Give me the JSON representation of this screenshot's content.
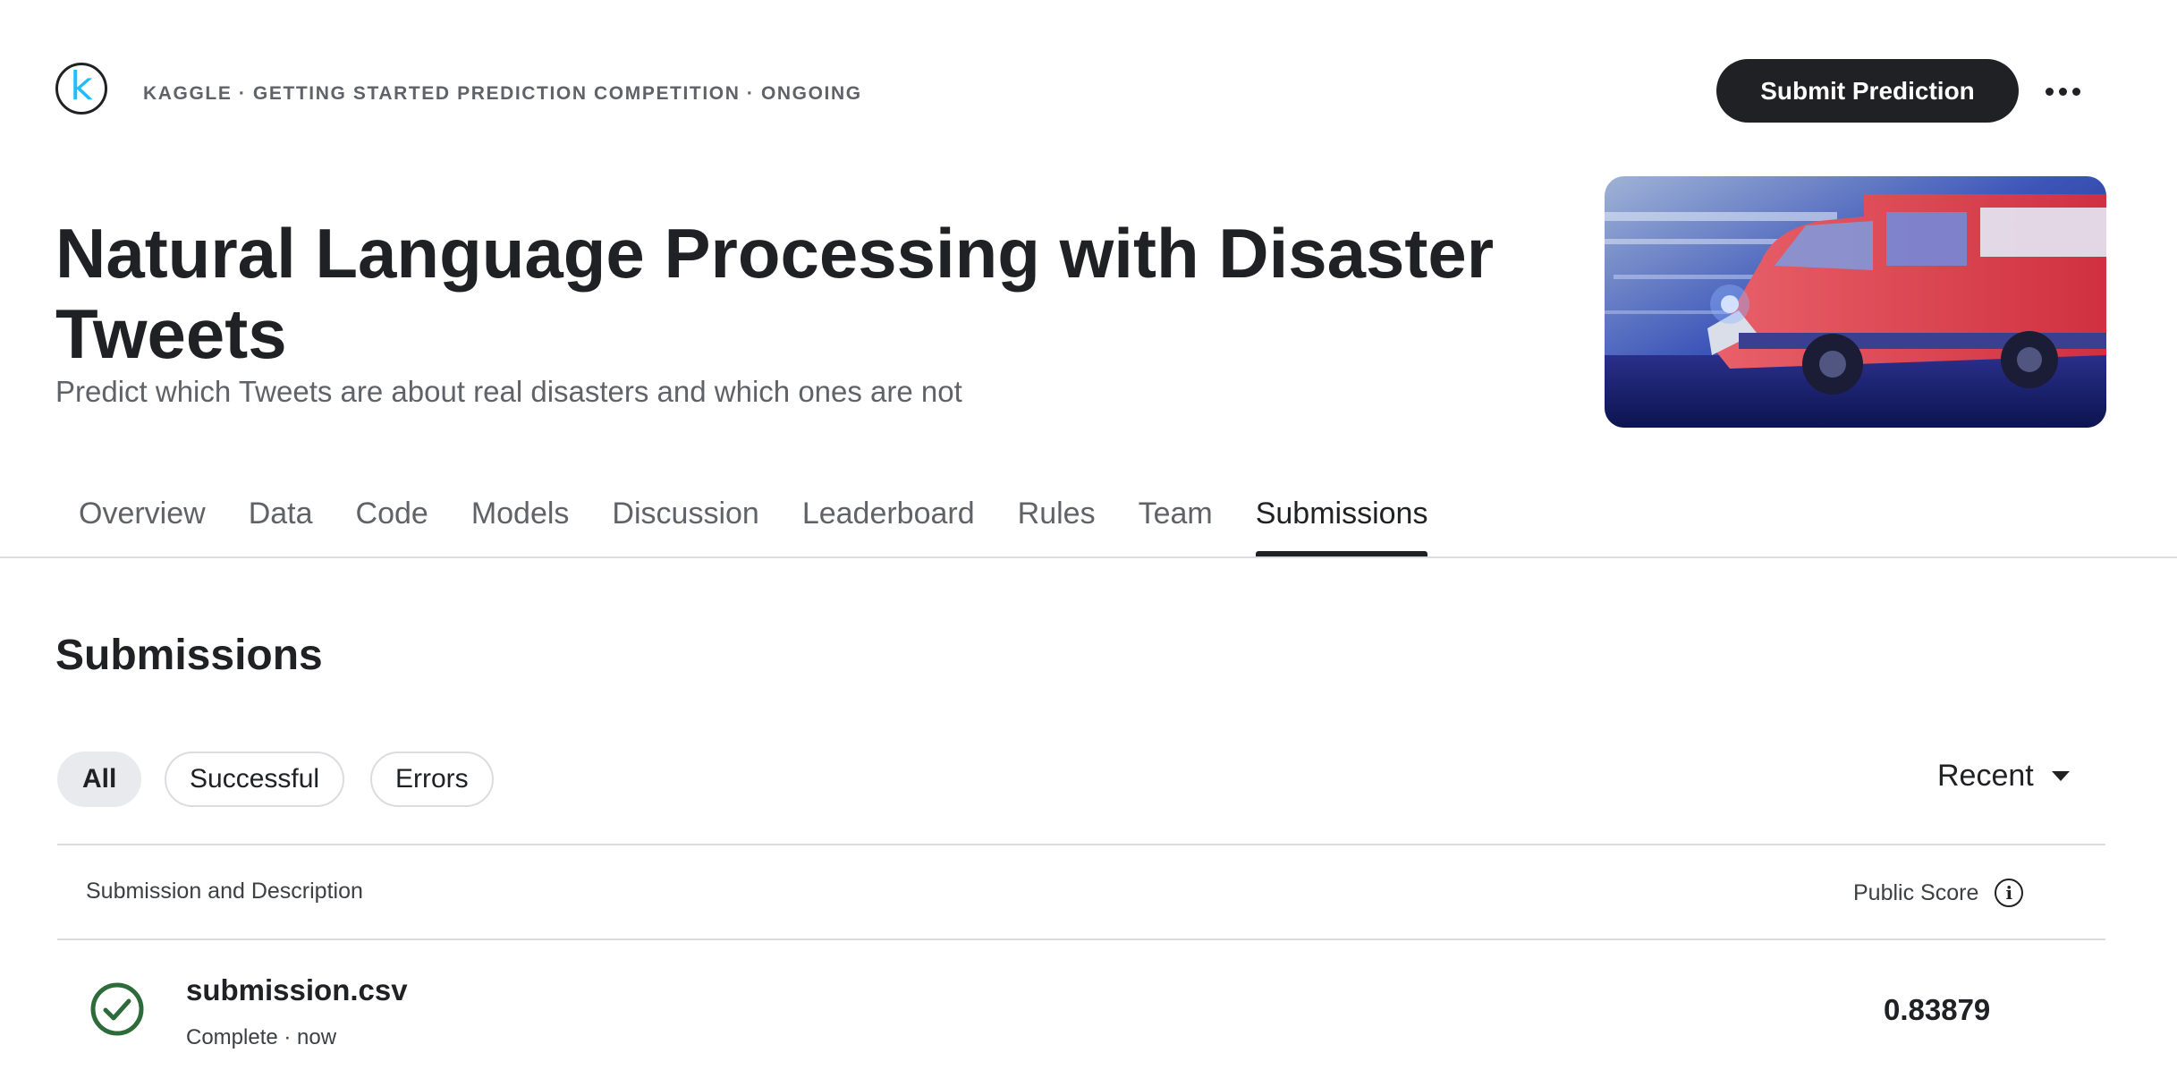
{
  "header": {
    "logo_letter": "k",
    "breadcrumb": "KAGGLE · GETTING STARTED PREDICTION COMPETITION · ONGOING",
    "submit_label": "Submit Prediction",
    "more_icon": "more-horizontal-icon"
  },
  "competition": {
    "title": "Natural Language Processing with Disaster Tweets",
    "subtitle": "Predict which Tweets are about real disasters and which ones are not",
    "banner_image": "ambulance-motion-blur"
  },
  "tabs": [
    {
      "label": "Overview",
      "active": false
    },
    {
      "label": "Data",
      "active": false
    },
    {
      "label": "Code",
      "active": false
    },
    {
      "label": "Models",
      "active": false
    },
    {
      "label": "Discussion",
      "active": false
    },
    {
      "label": "Leaderboard",
      "active": false
    },
    {
      "label": "Rules",
      "active": false
    },
    {
      "label": "Team",
      "active": false
    },
    {
      "label": "Submissions",
      "active": true
    }
  ],
  "submissions": {
    "heading": "Submissions",
    "filters": [
      {
        "label": "All",
        "active": true
      },
      {
        "label": "Successful",
        "active": false
      },
      {
        "label": "Errors",
        "active": false
      }
    ],
    "sort_label": "Recent",
    "columns": {
      "left": "Submission and Description",
      "right": "Public Score",
      "info_icon": "info-icon"
    },
    "rows": [
      {
        "file": "submission.csv",
        "status": "Complete · now",
        "public_score": "0.83879",
        "status_icon": "check-circle-icon"
      }
    ]
  },
  "colors": {
    "primary_text": "#202124",
    "secondary_text": "#5f6368",
    "kaggle_blue": "#20BEFF",
    "success_green": "#2e6b3a",
    "divider": "#dadce0"
  }
}
